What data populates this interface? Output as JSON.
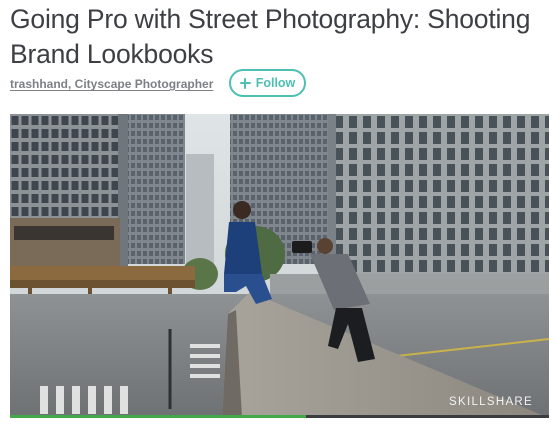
{
  "article": {
    "title": "Going Pro with Street Photography: Shooting Brand Lookbooks",
    "author": "trashhand, Cityscape Photographer"
  },
  "follow_button": {
    "label": "Follow",
    "icon": "plus-icon"
  },
  "video": {
    "watermark": "SKILLSHARE",
    "progress": 0.55
  },
  "colors": {
    "accent": "#4dbfb3",
    "title": "#3d3f44",
    "author": "#7d8085",
    "progress": "#43a84a"
  }
}
